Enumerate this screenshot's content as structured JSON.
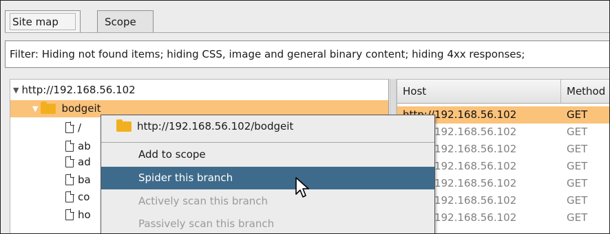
{
  "tabs": [
    {
      "label": "Site map",
      "active": true
    },
    {
      "label": "Scope",
      "active": false
    }
  ],
  "filter": {
    "text": "Filter: Hiding not found items;  hiding CSS, image and general binary content;  hiding 4xx responses;"
  },
  "tree": {
    "root": "http://192.168.56.102",
    "folder": "bodgeit",
    "children": [
      "/",
      "ab",
      "ad",
      "ba",
      "co",
      "ho"
    ]
  },
  "table": {
    "columns": [
      "Host",
      "Method"
    ],
    "rows": [
      {
        "host": "http://192.168.56.102",
        "method": "GET",
        "selected": true
      },
      {
        "host": "http://192.168.56.102",
        "method": "GET"
      },
      {
        "host": "http://192.168.56.102",
        "method": "GET"
      },
      {
        "host": "http://192.168.56.102",
        "method": "GET"
      },
      {
        "host": "http://192.168.56.102",
        "method": "GET"
      },
      {
        "host": "http://192.168.56.102",
        "method": "GET"
      },
      {
        "host": "http://192.168.56.102",
        "method": "GET"
      }
    ]
  },
  "context_menu": {
    "header": "http://192.168.56.102/bodgeit",
    "items": [
      {
        "label": "Add to scope",
        "enabled": true
      },
      {
        "label": "Spider this branch",
        "enabled": true,
        "highlighted": true
      },
      {
        "label": "Actively scan this branch",
        "enabled": false
      },
      {
        "label": "Passively scan this branch",
        "enabled": false
      }
    ]
  },
  "colors": {
    "selection": "#fbc27a",
    "menu_highlight": "#3e6b8b",
    "folder": "#f2b020",
    "disabled_text": "#9a9a9a"
  }
}
